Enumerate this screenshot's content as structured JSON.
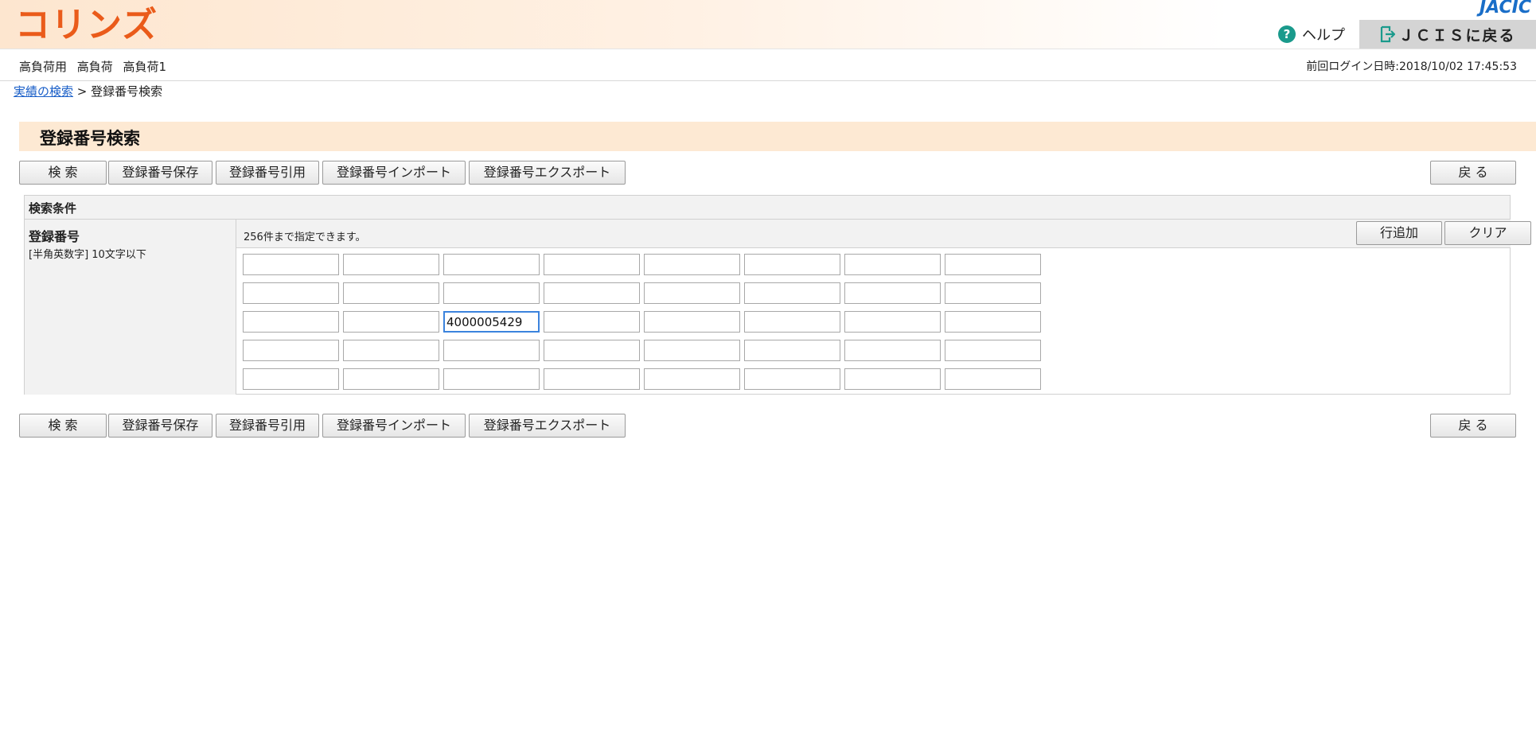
{
  "header": {
    "logo": "コリンズ",
    "brand": "JACIC",
    "help_label": "ヘルプ",
    "back_jcis_label": "ＪＣＩＳに戻る"
  },
  "userbar": {
    "user_name": "高負荷用 高負荷 高負荷1",
    "last_login": "前回ログイン日時:2018/10/02 17:45:53"
  },
  "breadcrumb": {
    "link": "実績の検索",
    "separator": ">",
    "current": "登録番号検索"
  },
  "page_title": "登録番号検索",
  "toolbar": {
    "search": "検 索",
    "save": "登録番号保存",
    "cite": "登録番号引用",
    "import": "登録番号インポート",
    "export": "登録番号エクスポート",
    "back": "戻 る"
  },
  "conditions": {
    "header": "検索条件",
    "label": "登録番号",
    "sublabel": "[半角英数字] 10文字以下",
    "note": "256件まで指定できます。",
    "add_row": "行追加",
    "clear": "クリア",
    "rows": [
      [
        "",
        "",
        "",
        "",
        "",
        "",
        "",
        ""
      ],
      [
        "",
        "",
        "",
        "",
        "",
        "",
        "",
        ""
      ],
      [
        "",
        "",
        "4000005429",
        "",
        "",
        "",
        "",
        ""
      ],
      [
        "",
        "",
        "",
        "",
        "",
        "",
        "",
        ""
      ],
      [
        "",
        "",
        "",
        "",
        "",
        "",
        "",
        ""
      ]
    ]
  },
  "colors": {
    "logo": "#ea5b1a",
    "title_bar": "#fde9d3",
    "link": "#1a5fc8",
    "help_icon": "#1a9a8c",
    "focus_border": "#3b83dd"
  }
}
